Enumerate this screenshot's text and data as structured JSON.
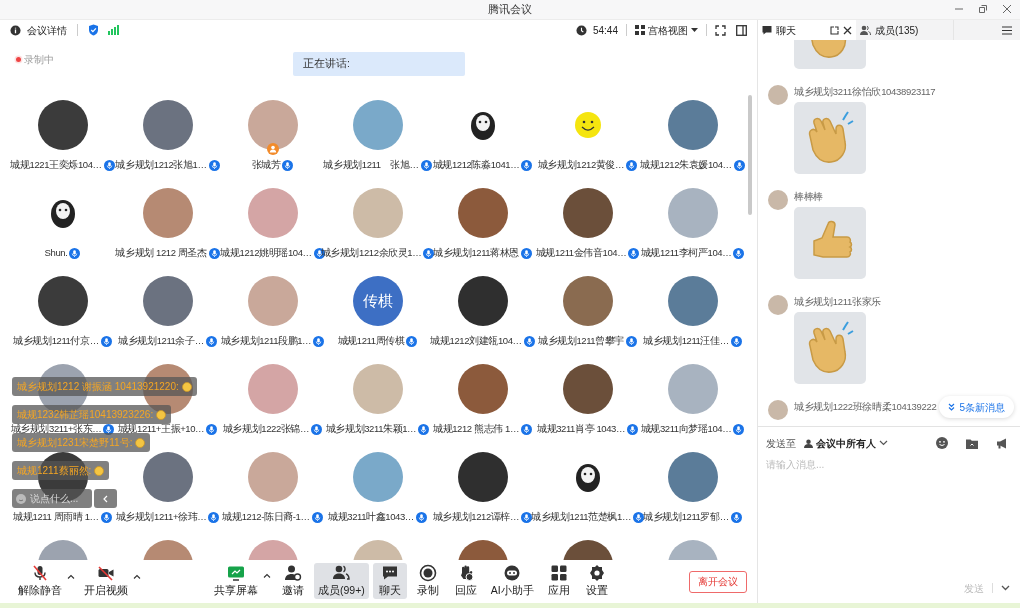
{
  "window": {
    "title": "腾讯会议"
  },
  "topbar": {
    "details": "会议详情",
    "timer": "54:44",
    "view": "宫格视图"
  },
  "recording": {
    "label": "录制中"
  },
  "speaking": {
    "label": "正在讲话:"
  },
  "participants": [
    {
      "name": "城规1221王奕烁104…",
      "kind": "photo",
      "host": false
    },
    {
      "name": "城乡规划1212张旭1…",
      "kind": "photo",
      "host": false
    },
    {
      "name": "张城芳",
      "kind": "photo",
      "host": true
    },
    {
      "name": "城乡规划1211　张旭…",
      "kind": "photo",
      "host": false
    },
    {
      "name": "城规1212陈淼1041…",
      "kind": "sticker",
      "host": false
    },
    {
      "name": "城乡规划1212黄俊…",
      "kind": "smiley",
      "host": false
    },
    {
      "name": "城规1212朱袁媛104…",
      "kind": "photo",
      "host": false
    },
    {
      "name": "Shun.",
      "kind": "sticker",
      "host": false
    },
    {
      "name": "城乡规划 1212 周圣杰",
      "kind": "photo",
      "host": false
    },
    {
      "name": "城规1212姚明瑶104…",
      "kind": "photo",
      "host": false
    },
    {
      "name": "城乡规划1212余欣灵1…",
      "kind": "photo",
      "host": false
    },
    {
      "name": "城乡规划1211蒋林恩",
      "kind": "photo",
      "host": false
    },
    {
      "name": "城规1211金伟音104…",
      "kind": "photo",
      "host": false
    },
    {
      "name": "城规1211李柯严104…",
      "kind": "photo",
      "host": false
    },
    {
      "name": "城乡规划1211付京…",
      "kind": "photo",
      "host": false
    },
    {
      "name": "城乡规划1211余子…",
      "kind": "photo",
      "host": false
    },
    {
      "name": "城乡规划1211段鹏1…",
      "kind": "photo",
      "host": false
    },
    {
      "name": "城规1211周传棋",
      "kind": "text",
      "avatar_text": "传棋",
      "host": false
    },
    {
      "name": "城规1212刘建瓴104…",
      "kind": "photo",
      "host": false
    },
    {
      "name": "城乡规划1211曾攀宇",
      "kind": "photo",
      "host": false
    },
    {
      "name": "城乡规划1211汪佳…",
      "kind": "photo",
      "host": false
    },
    {
      "name": "城乡规划3211+张东…",
      "kind": "photo",
      "host": false
    },
    {
      "name": "城规1211+王振+10…",
      "kind": "photo",
      "host": false
    },
    {
      "name": "城乡规划1222张锦…",
      "kind": "photo",
      "host": false
    },
    {
      "name": "城乡规划3211朱颖1…",
      "kind": "photo",
      "host": false
    },
    {
      "name": "城规1212 熊志伟 1…",
      "kind": "photo",
      "host": false
    },
    {
      "name": "城规3211肖亭 1043…",
      "kind": "photo",
      "host": false
    },
    {
      "name": "城规3211向梦瑶104…",
      "kind": "photo",
      "host": false
    },
    {
      "name": "城规1211 周雨晴 1…",
      "kind": "photo",
      "host": false
    },
    {
      "name": "城乡规划1211+徐玮…",
      "kind": "photo",
      "host": false
    },
    {
      "name": "城规1212-陈日裔-1…",
      "kind": "photo",
      "host": false
    },
    {
      "name": "城规3211叶鑫1043…",
      "kind": "photo",
      "host": false
    },
    {
      "name": "城乡规划1212谭梓…",
      "kind": "photo",
      "host": false
    },
    {
      "name": "城乡规划1211范楚枫1…",
      "kind": "sticker",
      "host": false
    },
    {
      "name": "城乡规划1211罗郁…",
      "kind": "photo",
      "host": false
    },
    {
      "kind": "photo"
    },
    {
      "kind": "photo"
    },
    {
      "kind": "photo"
    },
    {
      "kind": "photo"
    },
    {
      "kind": "photo"
    },
    {
      "kind": "photo"
    },
    {
      "kind": "photo"
    }
  ],
  "chat_overlay": {
    "messages": [
      "城乡规划1212 谢振涵 10413921220:",
      "城规1232韩芷瑶10413923226:",
      "城乡规划1231宋楚野11号:",
      "城规1211蔡丽然:"
    ],
    "placeholder": "说点什么..."
  },
  "controls": {
    "left": [
      {
        "label": "解除静音",
        "kind": "mic_off",
        "menu": true,
        "selected": false
      },
      {
        "label": "开启视频",
        "kind": "camera_off",
        "menu": true,
        "selected": false
      }
    ],
    "center": [
      {
        "label": "共享屏幕",
        "kind": "share",
        "menu": true,
        "selected": false
      },
      {
        "label": "邀请",
        "kind": "invite",
        "menu": false,
        "selected": false
      },
      {
        "label": "成员(99+)",
        "kind": "members",
        "menu": false,
        "selected": true
      },
      {
        "label": "聊天",
        "kind": "chat",
        "menu": false,
        "selected": true
      },
      {
        "label": "录制",
        "kind": "record",
        "menu": false,
        "selected": false
      },
      {
        "label": "回应",
        "kind": "react",
        "menu": false,
        "selected": false
      },
      {
        "label": "AI小助手",
        "kind": "ai",
        "menu": false,
        "selected": false
      },
      {
        "label": "应用",
        "kind": "apps",
        "menu": false,
        "selected": false
      },
      {
        "label": "设置",
        "kind": "settings",
        "menu": false,
        "selected": false
      }
    ]
  },
  "leave_button": "离开会议",
  "chat_panel": {
    "tabs": [
      {
        "label": "聊天",
        "selected": true
      },
      {
        "label": "成员(135)",
        "selected": false
      }
    ],
    "messages": [
      {
        "kind": "clap"
      },
      {
        "sender": "城乡规划3211徐怡欣10438923117",
        "kind": "clap"
      },
      {
        "sender": "棒棒棒",
        "kind": "thumbs_up"
      },
      {
        "sender": "城乡规划1211张家乐",
        "kind": "clap"
      },
      {
        "sender": "城乡规划1222班徐晴柔104139222"
      }
    ],
    "new_messages": "5条新消息",
    "send_to_label": "发送至",
    "recipient": "会议中所有人",
    "placeholder": "请输入消息...",
    "send_button": {
      "label": "发送",
      "disabled": true
    }
  }
}
